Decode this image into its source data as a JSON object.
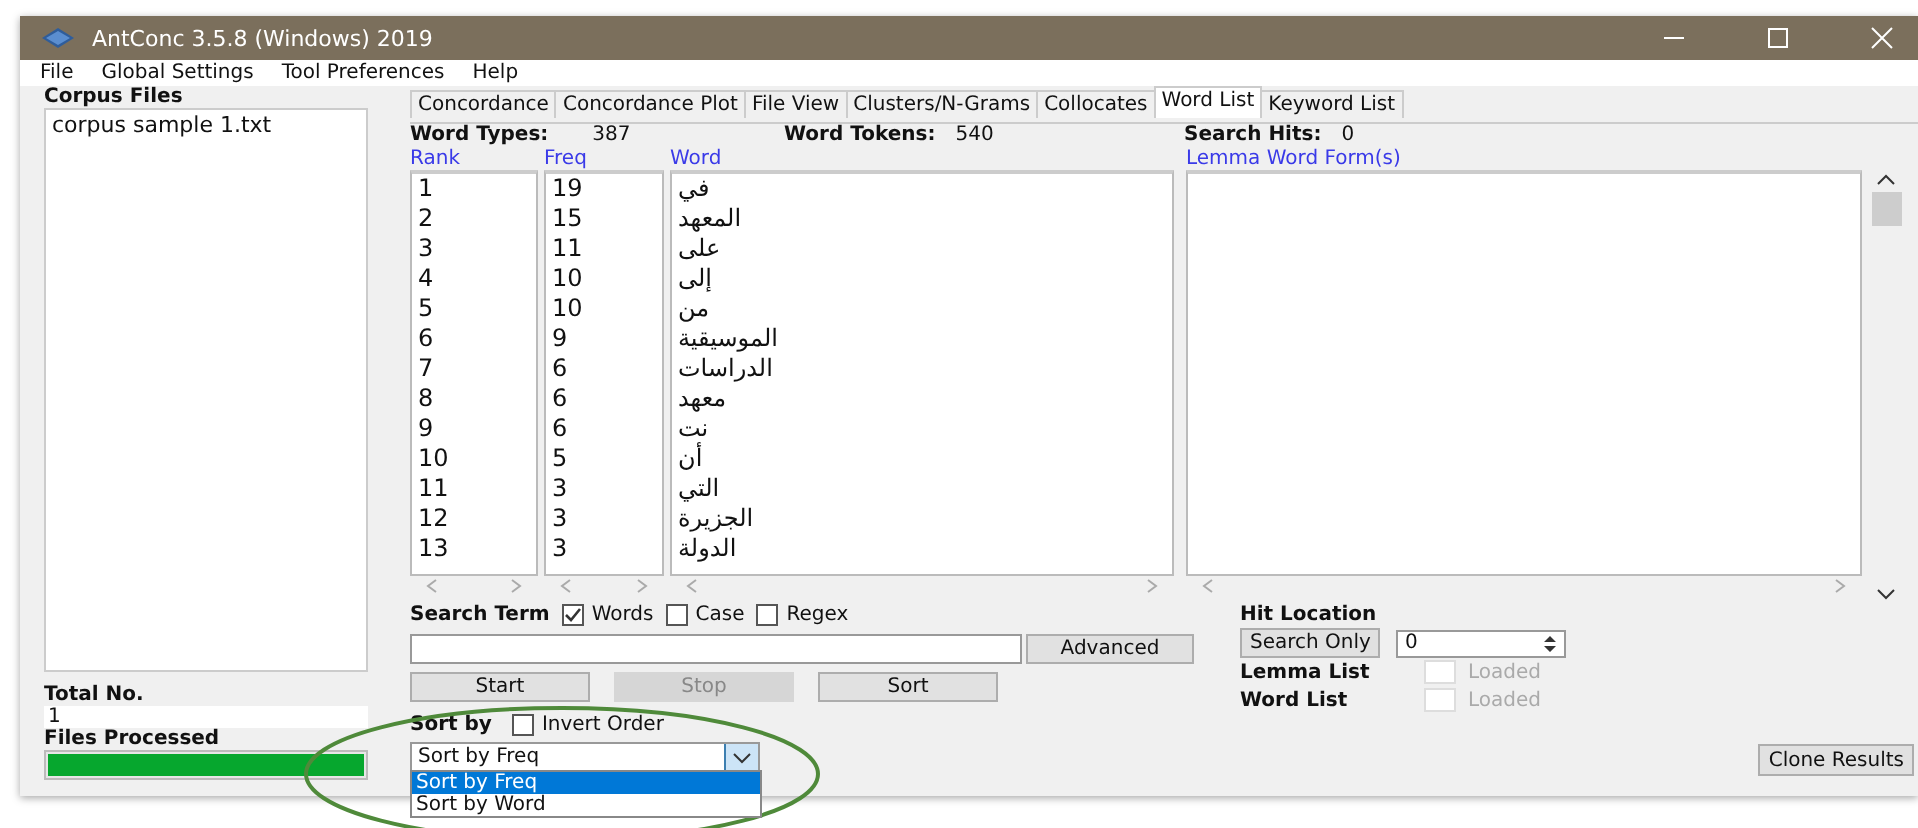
{
  "window": {
    "title": "AntConc 3.5.8 (Windows) 2019"
  },
  "menu": [
    "File",
    "Global Settings",
    "Tool Preferences",
    "Help"
  ],
  "sidebar": {
    "corpus_files_label": "Corpus Files",
    "files": [
      "corpus sample 1.txt"
    ],
    "total_label": "Total No.",
    "total_value": "1",
    "processed_label": "Files Processed",
    "progress": {
      "level": 1.0
    }
  },
  "tabs": [
    {
      "label": "Concordance",
      "selected": false
    },
    {
      "label": "Concordance Plot",
      "selected": false
    },
    {
      "label": "File View",
      "selected": false
    },
    {
      "label": "Clusters/N-Grams",
      "selected": false
    },
    {
      "label": "Collocates",
      "selected": false
    },
    {
      "label": "Word List",
      "selected": true
    },
    {
      "label": "Keyword List",
      "selected": false
    }
  ],
  "stats": [
    {
      "label": "Word Types:",
      "value": "387"
    },
    {
      "label": "Word Tokens:",
      "value": "540"
    },
    {
      "label": "Search Hits:",
      "value": "0"
    }
  ],
  "table": {
    "columns": [
      "Rank",
      "Freq",
      "Word",
      "Lemma Word Form(s)"
    ],
    "rows": [
      {
        "rank": "1",
        "freq": "19",
        "word": "في"
      },
      {
        "rank": "2",
        "freq": "15",
        "word": "المعهد"
      },
      {
        "rank": "3",
        "freq": "11",
        "word": "على"
      },
      {
        "rank": "4",
        "freq": "10",
        "word": "إلى"
      },
      {
        "rank": "5",
        "freq": "10",
        "word": "من"
      },
      {
        "rank": "6",
        "freq": "9",
        "word": "الموسيقية"
      },
      {
        "rank": "7",
        "freq": "6",
        "word": "الدراسات"
      },
      {
        "rank": "8",
        "freq": "6",
        "word": "معهد"
      },
      {
        "rank": "9",
        "freq": "6",
        "word": "نت"
      },
      {
        "rank": "10",
        "freq": "5",
        "word": "أن"
      },
      {
        "rank": "11",
        "freq": "3",
        "word": "التي"
      },
      {
        "rank": "12",
        "freq": "3",
        "word": "الجزيرة"
      },
      {
        "rank": "13",
        "freq": "3",
        "word": "الدولة"
      }
    ]
  },
  "search": {
    "label": "Search Term",
    "options": [
      {
        "label": "Words",
        "checked": true
      },
      {
        "label": "Case",
        "checked": false
      },
      {
        "label": "Regex",
        "checked": false
      }
    ],
    "advanced": "Advanced"
  },
  "buttons": [
    {
      "label": "Start",
      "disabled": false
    },
    {
      "label": "Stop",
      "disabled": true
    },
    {
      "label": "Sort",
      "disabled": false
    }
  ],
  "sort": {
    "label": "Sort by",
    "invert": {
      "label": "Invert Order",
      "checked": false
    },
    "value": "Sort by Freq",
    "options": [
      {
        "label": "Sort by Freq",
        "selected": true
      },
      {
        "label": "Sort by Word",
        "selected": false
      }
    ]
  },
  "hit_location": {
    "label": "Hit Location",
    "button": "Search Only",
    "spin_value": "0",
    "lists": [
      {
        "label": "Lemma List",
        "status": "Loaded",
        "checked": false,
        "disabled": true
      },
      {
        "label": "Word List",
        "status": "Loaded",
        "checked": false,
        "disabled": true
      }
    ]
  },
  "clone_button": "Clone Results"
}
